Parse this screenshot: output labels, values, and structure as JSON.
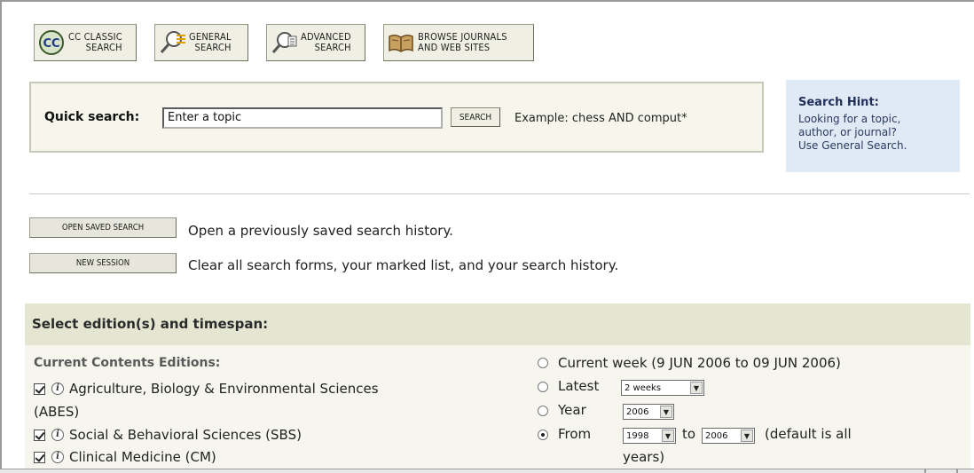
{
  "toolbar": {
    "buttons": [
      {
        "label": "CC CLASSIC\nSEARCH",
        "icon": "cc-icon"
      },
      {
        "label": "GENERAL\nSEARCH",
        "icon": "magnifier-icon"
      },
      {
        "label": "ADVANCED\nSEARCH",
        "icon": "magnifier-list-icon"
      },
      {
        "label": "BROWSE JOURNALS\nAND WEB SITES",
        "icon": "open-book-icon"
      }
    ]
  },
  "quick_search": {
    "label": "Quick search:",
    "input_value": "Enter a topic",
    "button_label": "SEARCH",
    "example": "Example: chess AND comput*"
  },
  "hint": {
    "title": "Search Hint:",
    "text": "Looking for a topic,\nauthor, or journal?\nUse General Search."
  },
  "actions": {
    "open_saved": {
      "label": "OPEN SAVED SEARCH",
      "desc": "Open a previously saved search history."
    },
    "new_session": {
      "label": "NEW SESSION",
      "desc": "Clear all search forms, your marked list, and your search history."
    }
  },
  "editions": {
    "section_title": "Select edition(s) and timespan:",
    "group_title": "Current Contents Editions:",
    "items": [
      {
        "label": "Agriculture, Biology & Environmental Sciences",
        "continuation": "(ABES)",
        "checked": true
      },
      {
        "label": "Social & Behavioral Sciences (SBS)",
        "checked": true
      },
      {
        "label": "Clinical Medicine (CM)",
        "checked": true
      }
    ]
  },
  "timespan": {
    "current_week": "Current week (9 JUN 2006 to 09 JUN 2006)",
    "latest_label": "Latest",
    "latest_value": "2 weeks",
    "year_label": "Year",
    "year_value": "2006",
    "from_label": "From",
    "from_value": "1998",
    "to_label": "to",
    "to_value": "2006",
    "default_note": "(default is all",
    "default_note_2": "years)",
    "selected": "from"
  }
}
